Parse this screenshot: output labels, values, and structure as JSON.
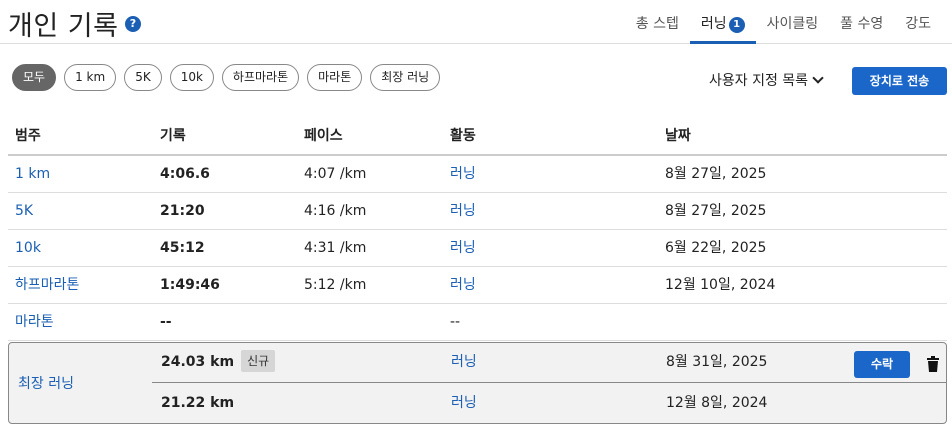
{
  "header": {
    "title": "개인 기록",
    "help_icon": "?",
    "tabs": [
      {
        "label": "총 스텝",
        "active": false
      },
      {
        "label": "러닝",
        "badge": "1",
        "active": true
      },
      {
        "label": "사이클링",
        "active": false
      },
      {
        "label": "풀 수영",
        "active": false
      },
      {
        "label": "강도",
        "active": false
      }
    ]
  },
  "filters": [
    "모두",
    "1 km",
    "5K",
    "10k",
    "하프마라톤",
    "마라톤",
    "최장 러닝"
  ],
  "active_filter": "모두",
  "custom_list_label": "사용자 지정 목록",
  "send_button": "장치로 전송",
  "table": {
    "columns": [
      "범주",
      "기록",
      "페이스",
      "활동",
      "날짜"
    ],
    "rows": [
      {
        "category": "1 km",
        "record": "4:06.6",
        "pace": "4:07 /km",
        "activity": "러닝",
        "date": "8월 27일, 2025"
      },
      {
        "category": "5K",
        "record": "21:20",
        "pace": "4:16 /km",
        "activity": "러닝",
        "date": "8월 27일, 2025"
      },
      {
        "category": "10k",
        "record": "45:12",
        "pace": "4:31 /km",
        "activity": "러닝",
        "date": "6월 22일, 2025"
      },
      {
        "category": "하프마라톤",
        "record": "1:49:46",
        "pace": "5:12 /km",
        "activity": "러닝",
        "date": "12월 10일, 2024"
      },
      {
        "category": "마라톤",
        "record": "--",
        "pace": "",
        "activity": "--",
        "date": ""
      }
    ]
  },
  "longest_run": {
    "category": "최장 러닝",
    "entries": [
      {
        "record": "24.03 km",
        "badge": "신규",
        "activity": "러닝",
        "date": "8월 31일, 2025",
        "action": "수락"
      },
      {
        "record": "21.22 km",
        "activity": "러닝",
        "date": "12월 8일, 2024"
      }
    ]
  },
  "colors": {
    "accent": "#1a5fb4",
    "button": "#1a66c9",
    "active_chip": "#666666"
  }
}
